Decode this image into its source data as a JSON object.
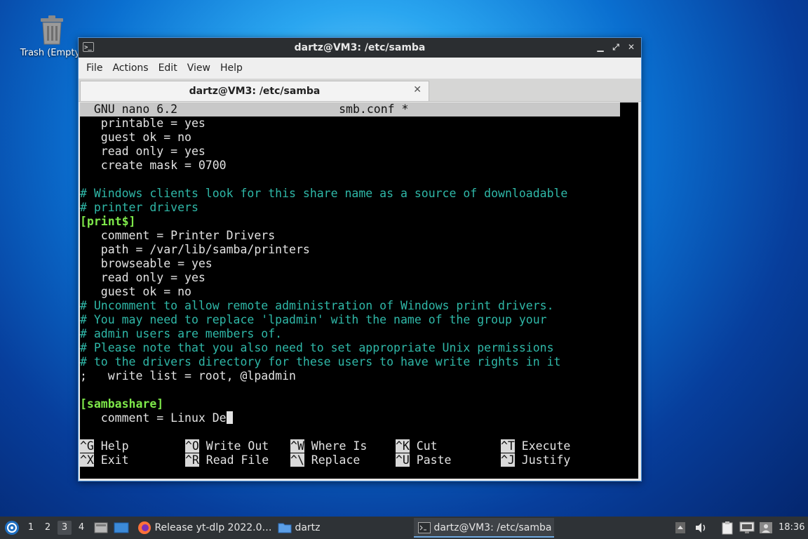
{
  "desktop": {
    "trash_label": "Trash (Empty)"
  },
  "window": {
    "title": "dartz@VM3: /etc/samba",
    "menu": [
      "File",
      "Actions",
      "Edit",
      "View",
      "Help"
    ],
    "tab_label": "dartz@VM3: /etc/samba"
  },
  "nano": {
    "version": "GNU nano 6.2",
    "filename": "smb.conf *",
    "lines": [
      {
        "t": "   printable = yes",
        "c": "txt"
      },
      {
        "t": "   guest ok = no",
        "c": "txt"
      },
      {
        "t": "   read only = yes",
        "c": "txt"
      },
      {
        "t": "   create mask = 0700",
        "c": "txt"
      },
      {
        "t": "",
        "c": "txt"
      },
      {
        "t": "# Windows clients look for this share name as a source of downloadable",
        "c": "com"
      },
      {
        "t": "# printer drivers",
        "c": "com"
      },
      {
        "t": "[print$]",
        "c": "sec"
      },
      {
        "t": "   comment = Printer Drivers",
        "c": "txt"
      },
      {
        "t": "   path = /var/lib/samba/printers",
        "c": "txt"
      },
      {
        "t": "   browseable = yes",
        "c": "txt"
      },
      {
        "t": "   read only = yes",
        "c": "txt"
      },
      {
        "t": "   guest ok = no",
        "c": "txt"
      },
      {
        "t": "# Uncomment to allow remote administration of Windows print drivers.",
        "c": "com"
      },
      {
        "t": "# You may need to replace 'lpadmin' with the name of the group your",
        "c": "com"
      },
      {
        "t": "# admin users are members of.",
        "c": "com"
      },
      {
        "t": "# Please note that you also need to set appropriate Unix permissions",
        "c": "com"
      },
      {
        "t": "# to the drivers directory for these users to have write rights in it",
        "c": "com"
      },
      {
        "t": ";   write list = root, @lpadmin",
        "c": "txt"
      },
      {
        "t": "",
        "c": "txt"
      },
      {
        "t": "[sambashare]",
        "c": "sec"
      },
      {
        "t": "   comment = Linux De",
        "c": "cur"
      }
    ],
    "shortcuts_row1": [
      {
        "key": "^G",
        "label": "Help"
      },
      {
        "key": "^O",
        "label": "Write Out"
      },
      {
        "key": "^W",
        "label": "Where Is"
      },
      {
        "key": "^K",
        "label": "Cut"
      },
      {
        "key": "^T",
        "label": "Execute"
      }
    ],
    "shortcuts_row2": [
      {
        "key": "^X",
        "label": "Exit"
      },
      {
        "key": "^R",
        "label": "Read File"
      },
      {
        "key": "^\\",
        "label": "Replace"
      },
      {
        "key": "^U",
        "label": "Paste"
      },
      {
        "key": "^J",
        "label": "Justify"
      }
    ]
  },
  "taskbar": {
    "workspaces": [
      "1",
      "2",
      "3",
      "4"
    ],
    "active_workspace": "3",
    "tasks": [
      {
        "label": "Release yt-dlp 2022.0…",
        "icon": "firefox-icon"
      },
      {
        "label": "dartz",
        "icon": "folder-icon"
      },
      {
        "label": "dartz@VM3: /etc/samba",
        "icon": "terminal-icon"
      }
    ],
    "clock": "18:36"
  },
  "colors": {
    "comment": "#2fb8a8",
    "section": "#7ee84a",
    "accent": "#4a90d9"
  }
}
